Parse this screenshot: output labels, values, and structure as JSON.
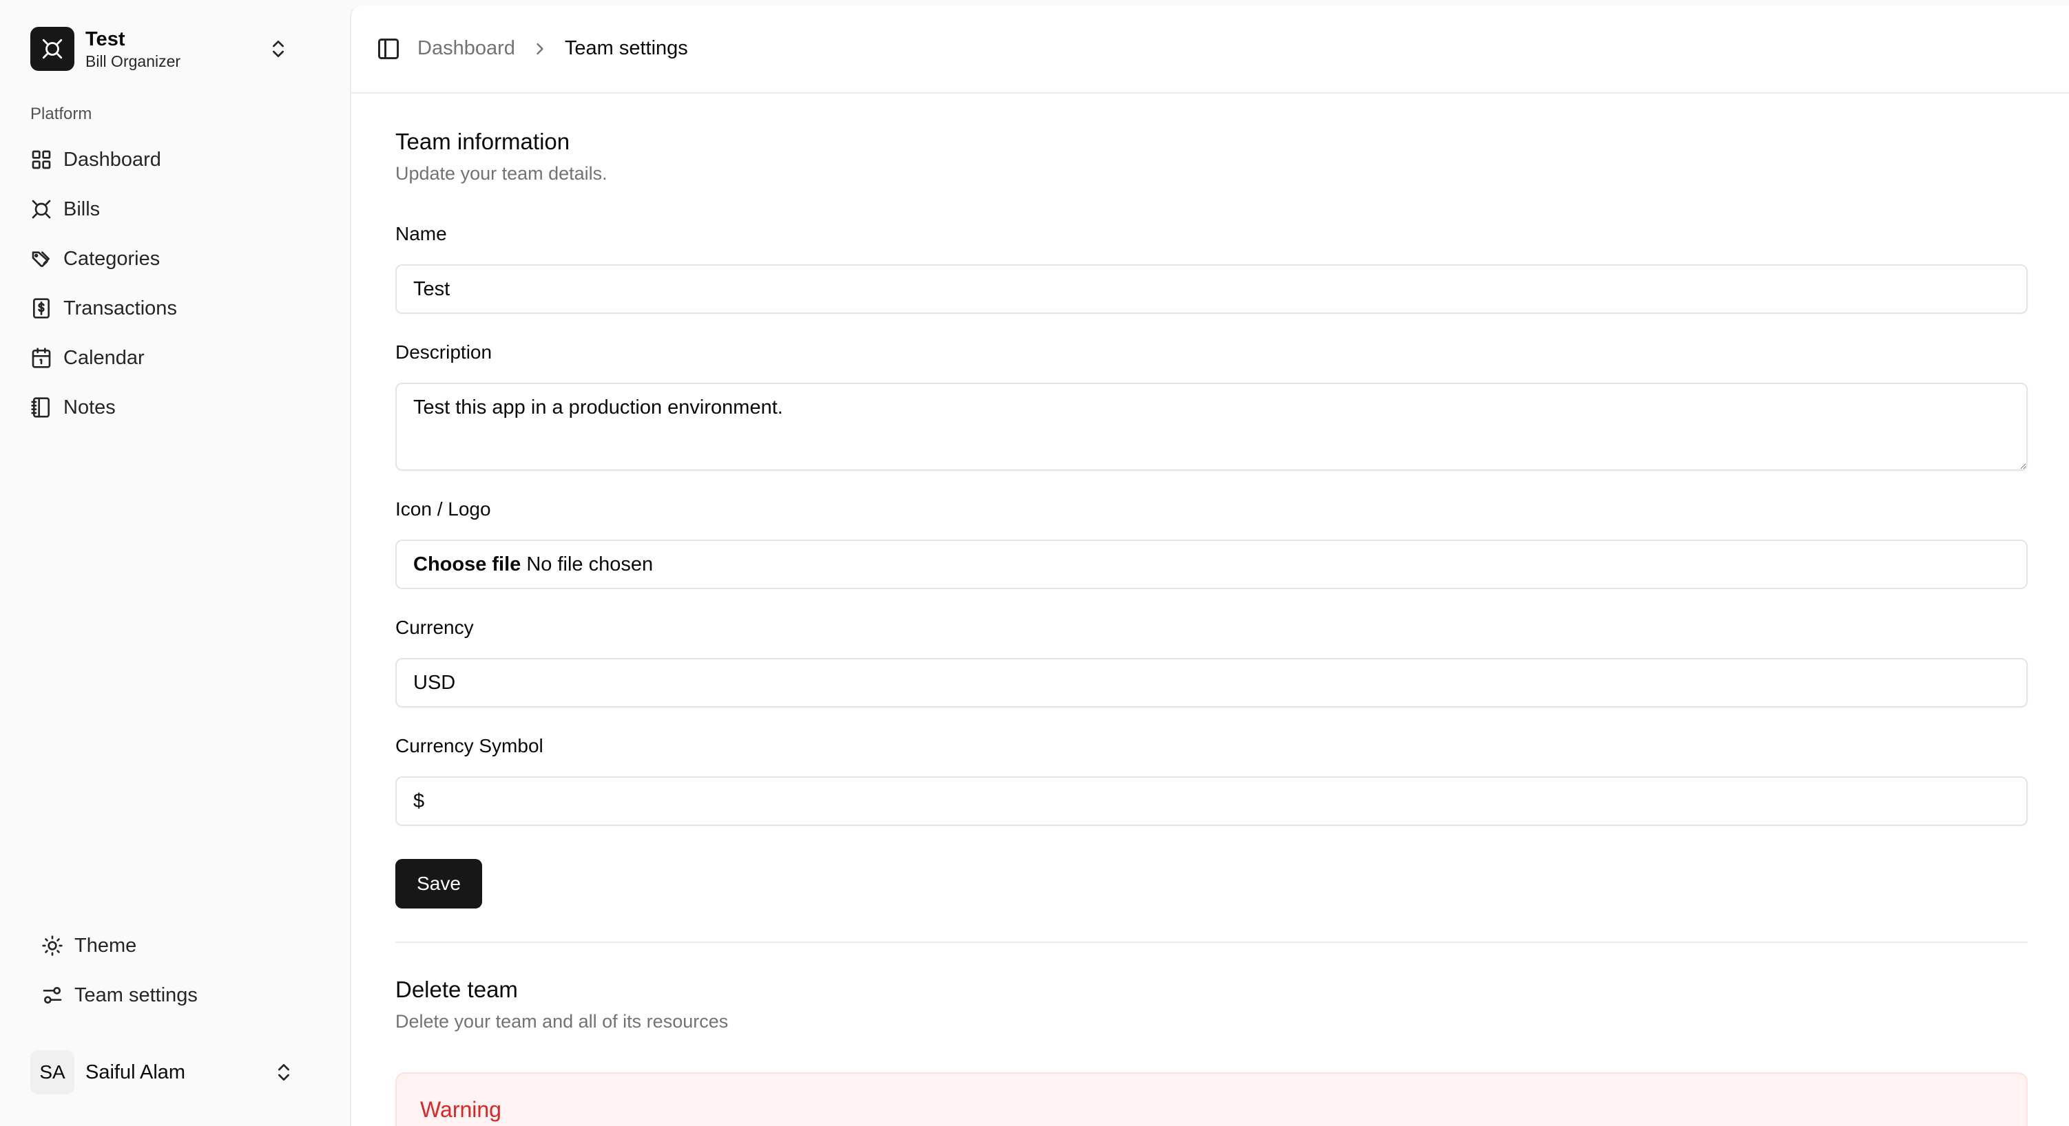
{
  "team": {
    "name": "Test",
    "plan": "Bill Organizer"
  },
  "sidebar": {
    "group_label": "Platform",
    "items": [
      {
        "label": "Dashboard",
        "icon": "layout-grid-icon"
      },
      {
        "label": "Bills",
        "icon": "bill-icon"
      },
      {
        "label": "Categories",
        "icon": "tags-icon"
      },
      {
        "label": "Transactions",
        "icon": "receipt-dollar-icon"
      },
      {
        "label": "Calendar",
        "icon": "calendar-icon"
      },
      {
        "label": "Notes",
        "icon": "notebook-icon"
      }
    ],
    "footer_items": [
      {
        "label": "Theme",
        "icon": "sun-icon"
      },
      {
        "label": "Team settings",
        "icon": "settings-sliders-icon"
      }
    ]
  },
  "user": {
    "initials": "SA",
    "name": "Saiful Alam"
  },
  "breadcrumb": {
    "parent": "Dashboard",
    "current": "Team settings"
  },
  "team_info": {
    "title": "Team information",
    "description": "Update your team details.",
    "name_label": "Name",
    "name_value": "Test",
    "description_label": "Description",
    "description_value": "Test this app in a production environment.",
    "logo_label": "Icon / Logo",
    "file_button": "Choose file",
    "file_status": "No file chosen",
    "currency_label": "Currency",
    "currency_value": "USD",
    "symbol_label": "Currency Symbol",
    "symbol_value": "$",
    "save_label": "Save"
  },
  "delete_team": {
    "title": "Delete team",
    "description": "Delete your team and all of its resources",
    "warning_title": "Warning"
  },
  "colors": {
    "primary": "#171717",
    "warning_text": "#dc2626",
    "warning_bg": "#fef2f2",
    "muted_text": "#737373",
    "border": "#e5e5e5"
  }
}
